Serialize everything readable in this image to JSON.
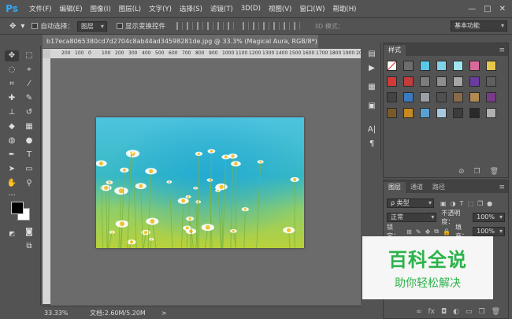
{
  "app": {
    "logo": "Ps"
  },
  "menu": [
    "文件(F)",
    "编辑(E)",
    "图像(I)",
    "图层(L)",
    "文字(Y)",
    "选择(S)",
    "滤镜(T)",
    "3D(D)",
    "视图(V)",
    "窗口(W)",
    "帮助(H)"
  ],
  "window_controls": {
    "minimize": "—",
    "maximize": "□",
    "close": "✕"
  },
  "options": {
    "auto_select_label": "自动选择：",
    "auto_select_value": "图层",
    "show_transform_label": "显示变换控件",
    "mode_3d": "3D 模式：",
    "workspace": "基本功能"
  },
  "document": {
    "tab_title": "b17eca8065380cd7d2704c8ab44ad34598281de.jpg @ 33.3% (Magical Aura, RGB/8*)",
    "close": "×"
  },
  "ruler_ticks": [
    "200",
    "100",
    "0",
    "100",
    "200",
    "300",
    "400",
    "500",
    "600",
    "700",
    "800",
    "900",
    "1000",
    "1100",
    "1200",
    "1300",
    "1400",
    "1500",
    "1600",
    "1700",
    "1800",
    "1900",
    "2000"
  ],
  "status": {
    "zoom": "33.33%",
    "doc_size": "文档:2.60M/5.20M",
    "arrow": ">"
  },
  "styles_panel": {
    "tab": "样式",
    "menu": "≡"
  },
  "layers_panel": {
    "tabs": [
      "图层",
      "通道",
      "路径"
    ],
    "menu": "≡",
    "filter_label": "ρ 类型",
    "blend_mode": "正常",
    "opacity_label": "不透明度：",
    "opacity_value": "100%",
    "lock_label": "锁定：",
    "fill_label": "填充：",
    "fill_value": "100%"
  },
  "watermark": {
    "title": "百科全说",
    "subtitle": "助你轻松解决"
  },
  "colors": {
    "accent": "#31a8ff",
    "watermark_green": "#2bb34a",
    "panel_bg": "#535353",
    "canvas_bg": "#6b6b6b"
  }
}
